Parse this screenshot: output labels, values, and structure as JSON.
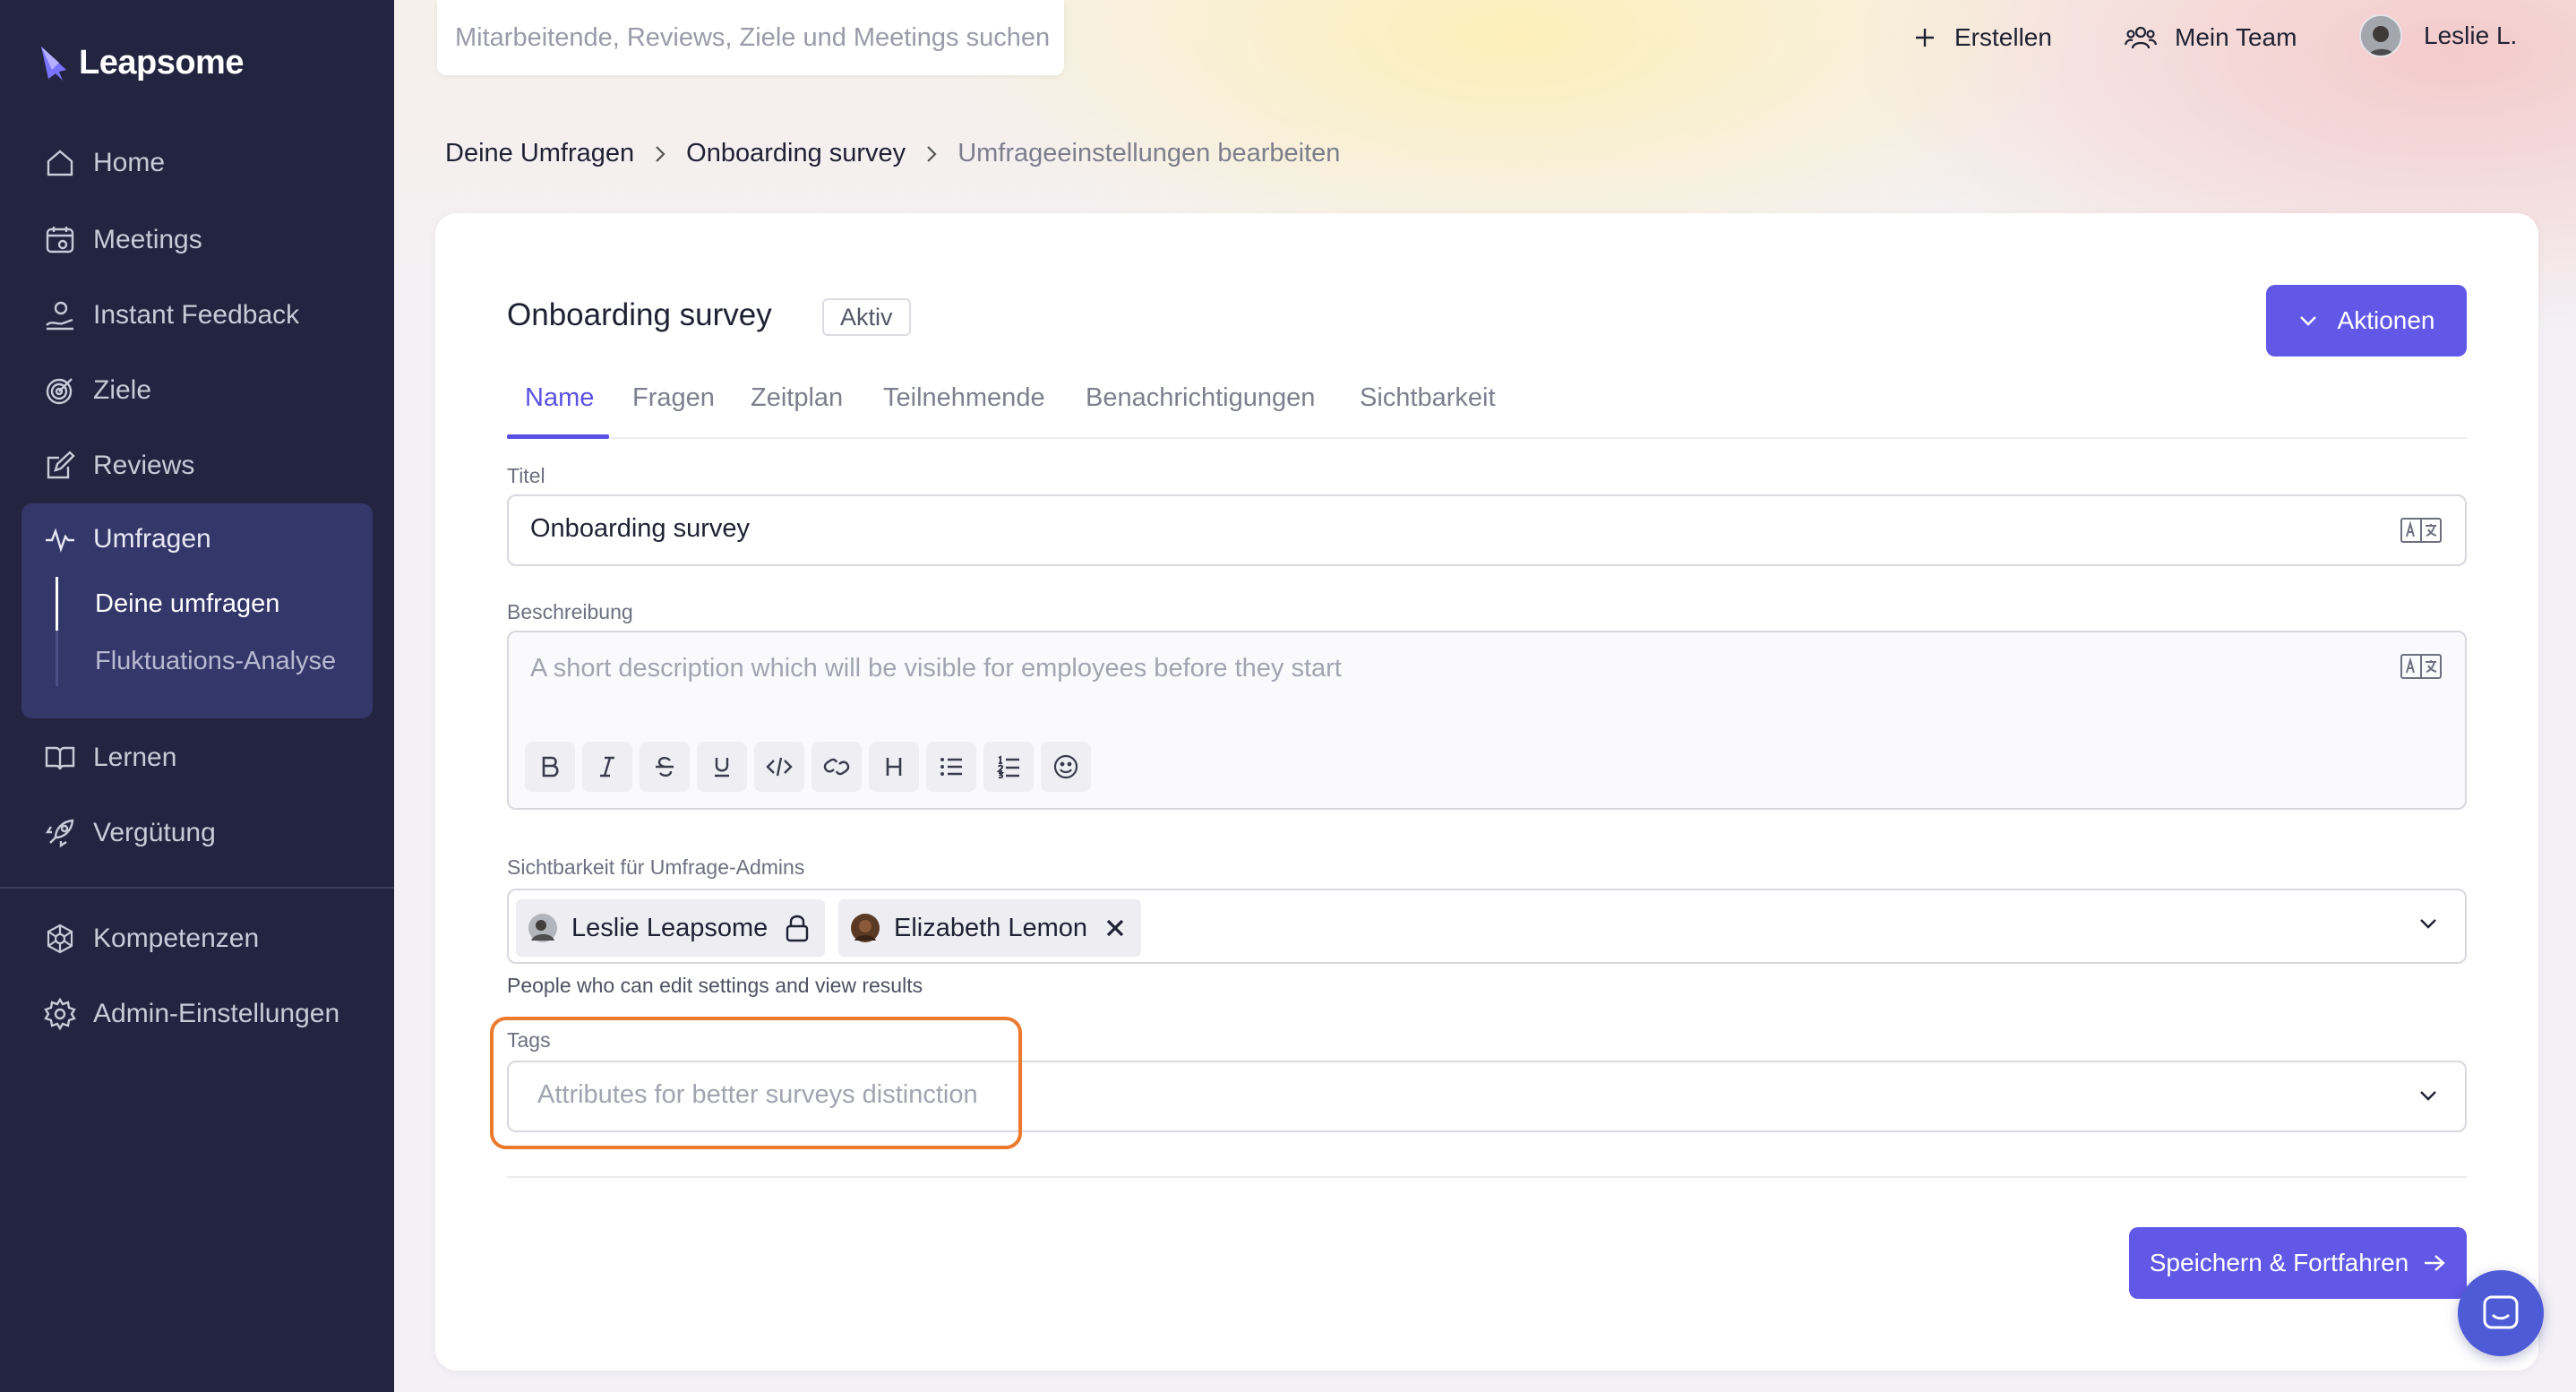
{
  "app": {
    "name": "Leapsome"
  },
  "sidebar": {
    "items": [
      {
        "label": "Home",
        "icon": "home-icon"
      },
      {
        "label": "Meetings",
        "icon": "calendar-icon"
      },
      {
        "label": "Instant Feedback",
        "icon": "feedback-icon"
      },
      {
        "label": "Ziele",
        "icon": "target-icon"
      },
      {
        "label": "Reviews",
        "icon": "edit-icon"
      },
      {
        "label": "Umfragen",
        "icon": "pulse-icon"
      },
      {
        "label": "Lernen",
        "icon": "book-icon"
      },
      {
        "label": "Vergütung",
        "icon": "rocket-icon"
      },
      {
        "label": "Kompetenzen",
        "icon": "network-icon"
      },
      {
        "label": "Admin-Einstellungen",
        "icon": "gear-icon"
      }
    ],
    "subitems": [
      {
        "label": "Deine umfragen",
        "active": true
      },
      {
        "label": "Fluktuations-Analyse",
        "active": false
      }
    ]
  },
  "topbar": {
    "search_placeholder": "Mitarbeitende, Reviews, Ziele und Meetings suchen",
    "create_label": "Erstellen",
    "team_label": "Mein Team",
    "user_label": "Leslie L."
  },
  "breadcrumb": [
    "Deine Umfragen",
    "Onboarding survey",
    "Umfrageeinstellungen bearbeiten"
  ],
  "survey": {
    "title": "Onboarding survey",
    "status": "Aktiv",
    "actions_label": "Aktionen"
  },
  "tabs": [
    "Name",
    "Fragen",
    "Zeitplan",
    "Teilnehmende",
    "Benachrichtigungen",
    "Sichtbarkeit"
  ],
  "active_tab": "Name",
  "form": {
    "title_label": "Titel",
    "title_value": "Onboarding survey",
    "description_label": "Beschreibung",
    "description_placeholder": "A short description which will be visible for employees before they start",
    "toolbar": [
      "bold-icon",
      "italic-icon",
      "strikethrough-icon",
      "underline-icon",
      "code-icon",
      "link-icon",
      "heading-icon",
      "bullet-list-icon",
      "numbered-list-icon",
      "emoji-icon"
    ],
    "admins_label": "Sichtbarkeit für Umfrage-Admins",
    "admins": [
      {
        "name": "Leslie Leapsome",
        "locked": true
      },
      {
        "name": "Elizabeth Lemon",
        "locked": false
      }
    ],
    "admins_helper": "People who can edit settings and view results",
    "tags_label": "Tags",
    "tags_placeholder": "Attributes for better surveys distinction"
  },
  "footer": {
    "save_label": "Speichern & Fortfahren"
  },
  "colors": {
    "sidebar_bg": "#232540",
    "sidebar_active_bg": "#343769",
    "accent": "#6158e8",
    "highlight": "#ec7a2e"
  }
}
